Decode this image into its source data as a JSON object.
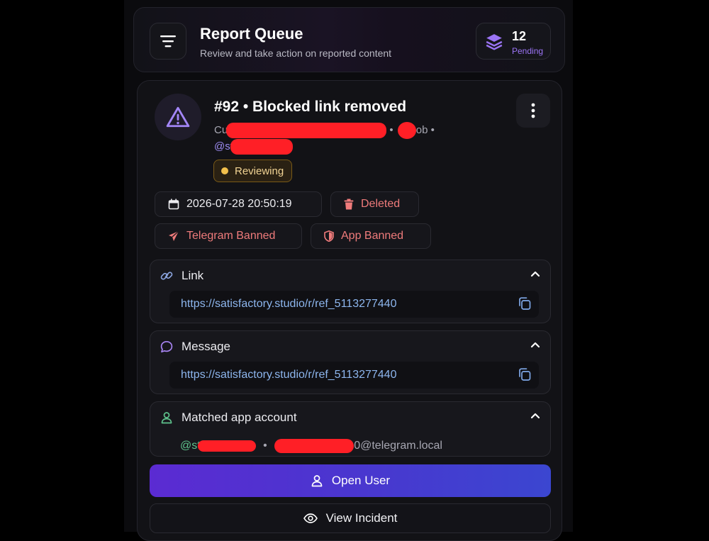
{
  "header": {
    "title": "Report Queue",
    "subtitle": "Review and take action on reported content",
    "pending_count": "12",
    "pending_label": "Pending"
  },
  "report": {
    "title": "#92 • Blocked link removed",
    "reporter_prefix": "Cu",
    "reporter_suffix": "ob •",
    "separator": "•",
    "handle_prefix": "@st",
    "status": "Reviewing",
    "timestamp": "2026-07-28 20:50:19",
    "deleted_label": "Deleted",
    "telegram_banned_label": "Telegram Banned",
    "app_banned_label": "App Banned"
  },
  "sections": {
    "link": {
      "label": "Link",
      "value": "https://satisfactory.studio/r/ref_5113277440"
    },
    "message": {
      "label": "Message",
      "value": "https://satisfactory.studio/r/ref_5113277440"
    },
    "account": {
      "label": "Matched app account",
      "handle_prefix": "@st",
      "separator": "•",
      "email_suffix": "0@telegram.local"
    }
  },
  "actions": {
    "open_user": "Open User",
    "view_incident": "View Incident"
  },
  "colors": {
    "accent_purple": "#9b74f5",
    "danger": "#ef7b7b",
    "status_yellow": "#f3c04c",
    "link_blue": "#8db6ee",
    "redaction": "#ff1f26"
  },
  "icons": [
    "menu-icon",
    "layers-icon",
    "warning-icon",
    "more-vertical-icon",
    "calendar-icon",
    "trash-icon",
    "send-icon",
    "shield-icon",
    "link-icon",
    "chevron-up-icon",
    "copy-icon",
    "message-icon",
    "user-icon",
    "eye-icon"
  ]
}
